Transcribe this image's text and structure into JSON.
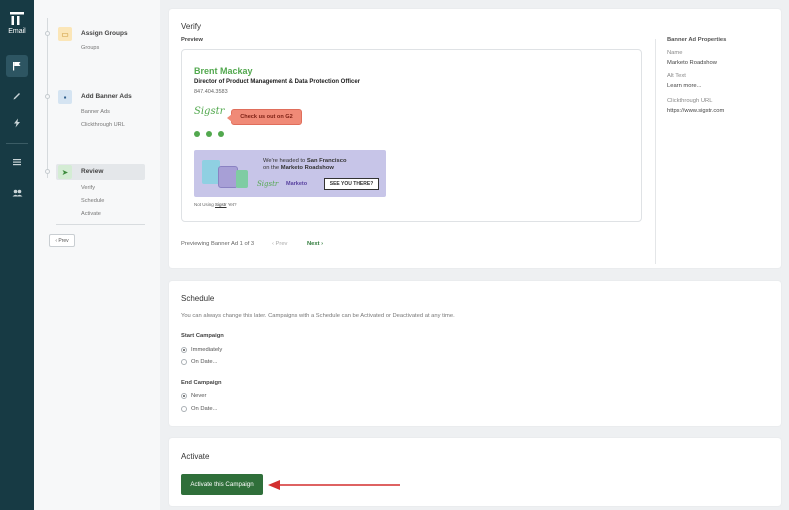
{
  "nav": {
    "logo_label": "Email",
    "icons": [
      "flag-icon",
      "pen-icon",
      "bolt-icon",
      "list-icon",
      "users-icon"
    ]
  },
  "stepper": {
    "steps": [
      {
        "title": "Assign Groups",
        "subs": [
          "Groups"
        ]
      },
      {
        "title": "Add Banner Ads",
        "subs": [
          "Banner Ads",
          "Clickthrough URL"
        ]
      },
      {
        "title": "Review",
        "subs": [
          "Verify",
          "Schedule",
          "Activate"
        ]
      }
    ],
    "prev_label": "‹ Prev"
  },
  "verify": {
    "title": "Verify",
    "preview_label": "Preview",
    "signature": {
      "name": "Brent Mackay",
      "job_title": "Director of Product Management & Data Protection Officer",
      "phone": "847.404.3583",
      "logo_text": "Sigstr",
      "badge": "Check us out on G2"
    },
    "banner": {
      "line1": "We're headed to ",
      "line1_bold": "San Francisco",
      "line2": "on the ",
      "line2_bold": "Marketo Roadshow",
      "sig_logo": "Sigstr",
      "marketo": "Marketo",
      "cta": "SEE YOU THERE?"
    },
    "not_using_prefix": "Not Using ",
    "not_using_link": "Sigstr",
    "not_using_suffix": " Yet?",
    "pager": {
      "status": "Previewing Banner Ad 1 of 3",
      "prev": "‹ Prev",
      "next": "Next ›"
    },
    "props": {
      "heading": "Banner Ad Properties",
      "name_label": "Name",
      "name_value": "Marketo Roadshow",
      "alt_label": "Alt Text",
      "alt_value": "Learn more...",
      "url_label": "Clickthrough URL",
      "url_value": "https://www.sigstr.com"
    }
  },
  "schedule": {
    "title": "Schedule",
    "description": "You can always change this later. Campaigns with a Schedule can be Activated or Deactivated at any time.",
    "start_label": "Start Campaign",
    "start_options": [
      {
        "label": "Immediately",
        "selected": true
      },
      {
        "label": "On Date...",
        "selected": false
      }
    ],
    "end_label": "End Campaign",
    "end_options": [
      {
        "label": "Never",
        "selected": true
      },
      {
        "label": "On Date...",
        "selected": false
      }
    ]
  },
  "activate": {
    "title": "Activate",
    "button_label": "Activate this Campaign"
  },
  "colors": {
    "nav_bg": "#173a44",
    "accent_green": "#52a84e",
    "button_green": "#2f6f3a",
    "badge": "#f08a77",
    "arrow_red": "#d32f2f"
  }
}
